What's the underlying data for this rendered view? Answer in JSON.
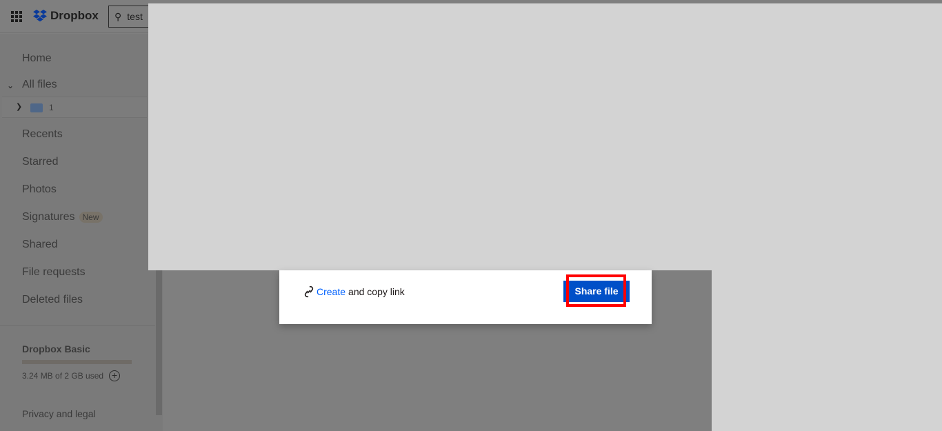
{
  "header": {
    "logo": "Dropbox",
    "search_value": "test"
  },
  "sidebar": {
    "items": [
      {
        "label": "Home"
      },
      {
        "label": "All files"
      },
      {
        "label": "Recents"
      },
      {
        "label": "Starred"
      },
      {
        "label": "Photos"
      },
      {
        "label": "Signatures",
        "badge": "New"
      },
      {
        "label": "Shared"
      },
      {
        "label": "File requests"
      },
      {
        "label": "Deleted files"
      }
    ],
    "tree": {
      "folder": "1"
    },
    "plan": "Dropbox Basic",
    "usage": "3.24 MB of 2 GB used",
    "storage_used_fraction": 0.0016,
    "footer": "Privacy and legal"
  },
  "modal": {
    "create_link": "Create",
    "link_suffix": "and copy link",
    "share_button": "Share file"
  },
  "colors": {
    "accent": "#0050c8",
    "link": "#0061fe",
    "highlight": "#ff0000"
  }
}
